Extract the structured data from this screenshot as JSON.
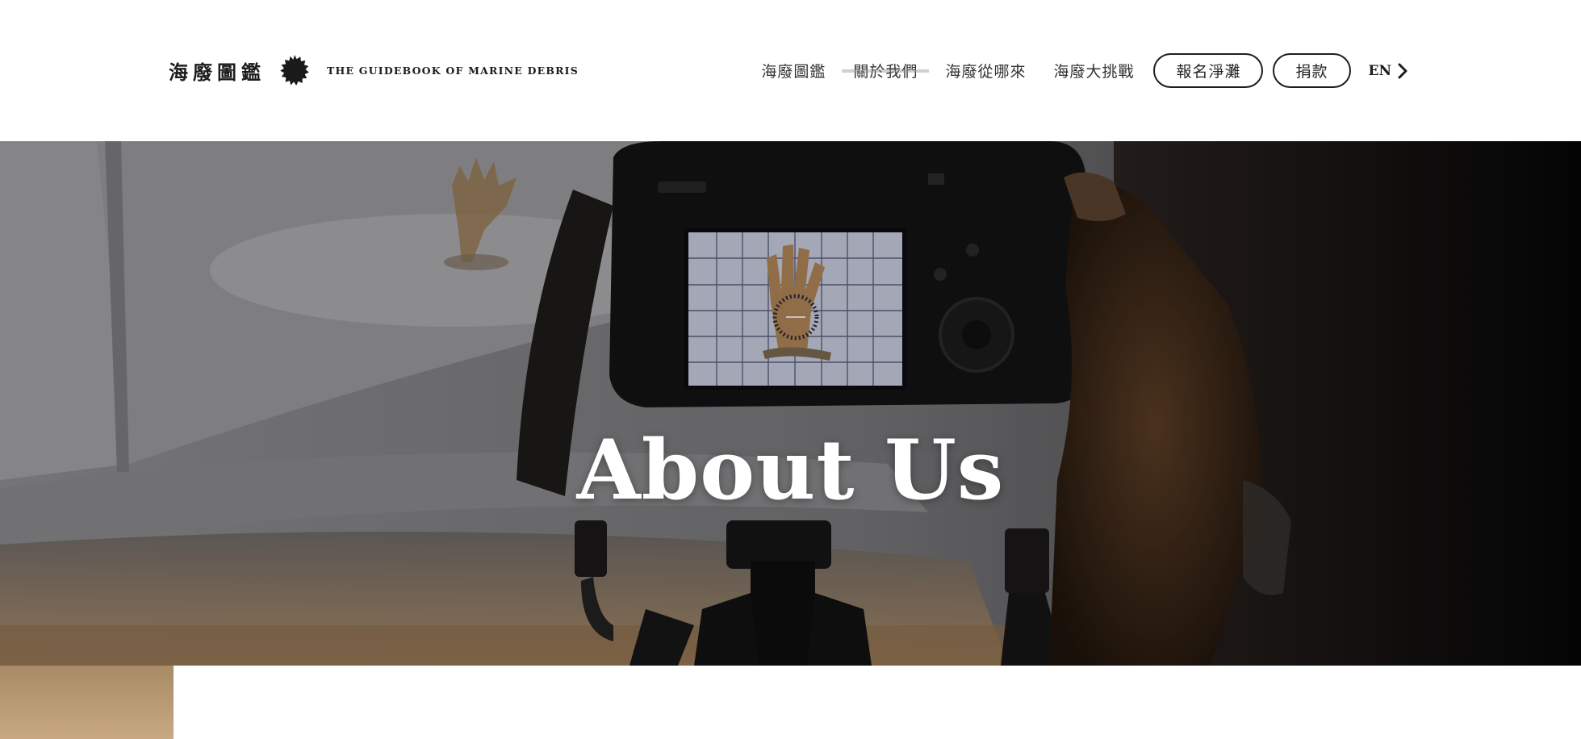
{
  "brand": {
    "name_zh": "海廢圖鑑",
    "name_en": "THE GUIDEBOOK OF MARINE DEBRIS",
    "seal_icon": "dark-seal-icon"
  },
  "nav": {
    "items": [
      {
        "label": "海廢圖鑑",
        "active": false
      },
      {
        "label": "關於我們",
        "active": true
      },
      {
        "label": "海廢從哪來",
        "active": false
      },
      {
        "label": "海廢大挑戰",
        "active": false
      }
    ],
    "pills": [
      {
        "label": "報名淨灘"
      },
      {
        "label": "捐款"
      }
    ],
    "language": {
      "label": "EN",
      "icon": "chevron-right-icon"
    }
  },
  "hero": {
    "title": "About Us"
  },
  "colors": {
    "text": "#222222",
    "hero_overlay": "#000000",
    "background": "#ffffff"
  }
}
